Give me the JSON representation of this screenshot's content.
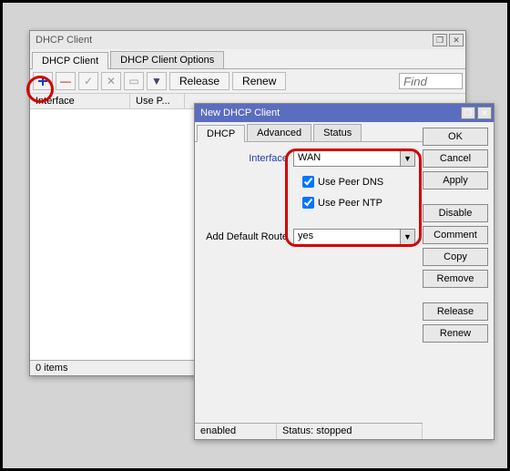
{
  "main_window": {
    "title": "DHCP Client",
    "tabs": [
      "DHCP Client",
      "DHCP Client Options"
    ],
    "toolbar": {
      "release": "Release",
      "renew": "Renew"
    },
    "find_placeholder": "Find",
    "columns": {
      "interface": "Interface",
      "usep": "Use P..."
    },
    "status": "0 items"
  },
  "dialog": {
    "title": "New DHCP Client",
    "tabs": [
      "DHCP",
      "Advanced",
      "Status"
    ],
    "form": {
      "interface_label": "Interface",
      "interface_value": "WAN",
      "use_peer_dns_label": "Use Peer DNS",
      "use_peer_ntp_label": "Use Peer NTP",
      "add_default_route_label": "Add Default Route",
      "add_default_route_value": "yes"
    },
    "buttons": {
      "ok": "OK",
      "cancel": "Cancel",
      "apply": "Apply",
      "disable": "Disable",
      "comment": "Comment",
      "copy": "Copy",
      "remove": "Remove",
      "release": "Release",
      "renew": "Renew"
    },
    "status": {
      "enabled": "enabled",
      "running": "Status: stopped"
    }
  }
}
